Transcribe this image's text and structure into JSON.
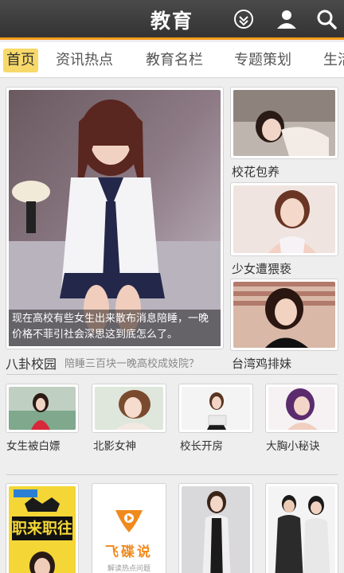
{
  "header": {
    "title": "教育",
    "icons": [
      "download-icon",
      "user-icon",
      "search-icon"
    ]
  },
  "tabs": [
    {
      "label": "首页",
      "active": true
    },
    {
      "label": "资讯热点",
      "active": false
    },
    {
      "label": "教育名栏",
      "active": false
    },
    {
      "label": "专题策划",
      "active": false
    },
    {
      "label": "生活",
      "active": false
    }
  ],
  "featured": {
    "caption": "现在高校有些女生出来散布消息陪睡，一晚价格不菲引社会深思这到底怎么了。",
    "section_label": "八卦校园",
    "section_sublabel": "陪睡三百块一晚高校成妓院？"
  },
  "side_items": [
    {
      "label": "校花包养"
    },
    {
      "label": "少女遭猥亵"
    },
    {
      "label": "台湾鸡排妹"
    }
  ],
  "row_items": [
    {
      "label": "女生被白嫖"
    },
    {
      "label": "北影女神"
    },
    {
      "label": "校长开房"
    },
    {
      "label": "大胸小秘诀"
    }
  ],
  "bottom_items": [
    {
      "title_text": "职来职往"
    },
    {
      "title_text": "飞碟说",
      "subtitle_text": "解读热点问题"
    },
    {
      "title_text": ""
    },
    {
      "title_text": ""
    }
  ],
  "colors": {
    "accent": "#f29a1c",
    "tab_active_bg": "#f7d96a",
    "header_bg": "#3c3c3c",
    "feitie_orange": "#f08a1d"
  }
}
